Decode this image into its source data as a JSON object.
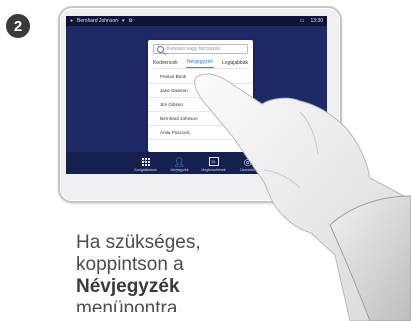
{
  "step": {
    "number": "2"
  },
  "statusbar": {
    "caller": "Bernhard Johnson",
    "time": "13:30"
  },
  "directory": {
    "search_placeholder": "Keresés vagy tárcsázás",
    "tabs": [
      "Kedvencek",
      "Névjegyzék",
      "Legújabbak"
    ],
    "active_tab_index": 1,
    "contacts": [
      "Pentus Book",
      "Jane Dawson",
      "Jim Gibson",
      "Bernhard Johnson",
      "Anita Puscovic"
    ]
  },
  "bottom_nav": [
    {
      "label": "Szolgáltatások",
      "icon": "grid-icon"
    },
    {
      "label": "Névjegyzék",
      "icon": "contacts-icon",
      "active": true
    },
    {
      "label": "Megbeszélések",
      "icon": "calendar-icon"
    },
    {
      "label": "Üzenetek",
      "icon": "messages-icon"
    }
  ],
  "caption": {
    "line1": "Ha szükséges,",
    "line2": "koppintson a",
    "line3": "Névjegyzék",
    "line4": "menüpontra."
  },
  "colors": {
    "screen_bg": "#1d2a66",
    "accent": "#2f7fd6"
  }
}
